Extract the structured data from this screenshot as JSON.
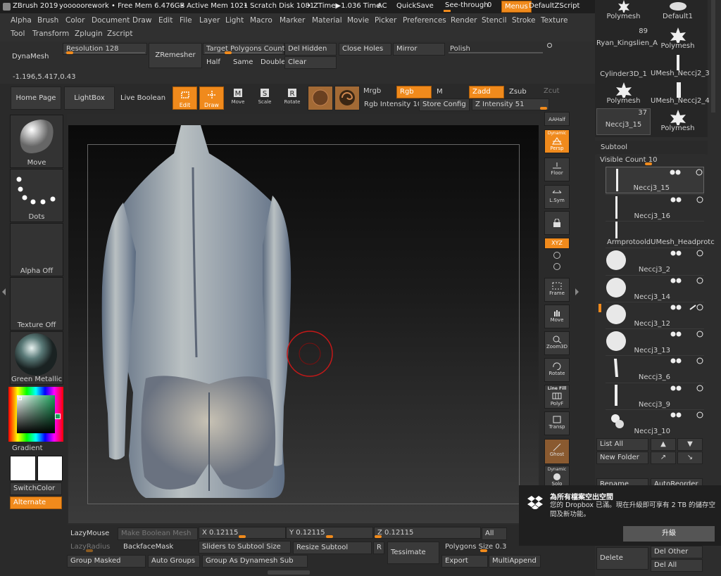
{
  "titlebar": {
    "app": "ZBrush 2019",
    "doc": "yooooorework",
    "free_mem": "• Free Mem 6.476GB",
    "active_mem": "• Active Mem 1021",
    "scratch": "• Scratch Disk 1081",
    "ztime": "• ZTime▶1.036 Time",
    "ac": "AC",
    "quicksave": "QuickSave",
    "see_through": "See-through",
    "see_through_val": "0",
    "menus": "Menus",
    "default_zscript": "DefaultZScript"
  },
  "menus": {
    "row1": [
      "Alpha",
      "Brush",
      "Color",
      "Document",
      "Draw",
      "Edit",
      "File",
      "Layer",
      "Light",
      "Macro",
      "Marker",
      "Material",
      "Movie",
      "Picker",
      "Preferences",
      "Render",
      "Stencil",
      "Stroke",
      "Texture"
    ],
    "row2": [
      "Tool",
      "Transform",
      "Zplugin",
      "Zscript"
    ]
  },
  "dynamesh": {
    "title": "DynaMesh",
    "resolution": "Resolution",
    "resolution_val": "128",
    "zremesher": "ZRemesher",
    "target_polys": "Target Polygons Count",
    "target_polys_val": "5",
    "half": "Half",
    "same": "Same",
    "double": "Double",
    "del_hidden": "Del Hidden",
    "clear": "Clear",
    "close_holes": "Close Holes",
    "mirror": "Mirror",
    "polish": "Polish",
    "coords": "-1.196,5.417,0.43"
  },
  "toolbar": {
    "home_page": "Home Page",
    "lightbox": "LightBox",
    "live_boolean": "Live Boolean",
    "edit": "Edit",
    "draw": "Draw",
    "move": "Move",
    "scale": "Scale",
    "rotate": "Rotate",
    "mrgb": "Mrgb",
    "rgb": "Rgb",
    "m": "M",
    "zadd": "Zadd",
    "zsub": "Zsub",
    "zcut": "Zcut",
    "rgb_intensity": "Rgb Intensity",
    "rgb_intensity_val": "100",
    "store_config": "Store Config",
    "z_intensity": "Z Intensity",
    "z_intensity_val": "51"
  },
  "left_shelf": {
    "brush": "Move",
    "stroke": "Dots",
    "alpha": "Alpha Off",
    "texture": "Texture Off",
    "material": "Green Metallic",
    "gradient": "Gradient",
    "switch_color": "SwitchColor",
    "alternate": "Alternate"
  },
  "right_shelf": {
    "aahalf": "AAHalf",
    "dynamic": "Dynamic",
    "persp": "Persp",
    "floor": "Floor",
    "lsym": "L.Sym",
    "xyz": "XYZ",
    "frame": "Frame",
    "move": "Move",
    "zoom3d": "Zoom3D",
    "rotate": "Rotate",
    "line_fill": "Line Fill",
    "polyf": "PolyF",
    "transp": "Transp",
    "ghost": "Ghost",
    "dynamic2": "Dynamic",
    "solo": "Solo"
  },
  "tool_thumbs": [
    {
      "label": "Polymesh",
      "count": ""
    },
    {
      "label": "Default1",
      "count": ""
    },
    {
      "label": "Ryan_Kingslien_A",
      "count": "89"
    },
    {
      "label": "Polymesh",
      "count": ""
    },
    {
      "label": "Cylinder3D_1",
      "count": ""
    },
    {
      "label": "UMesh_Neccj2_3",
      "count": ""
    },
    {
      "label": "Polymesh",
      "count": ""
    },
    {
      "label": "UMesh_Neccj2_4",
      "count": ""
    },
    {
      "label": "Neccj3_15",
      "count": "37"
    },
    {
      "label": "Polymesh",
      "count": ""
    }
  ],
  "subtool": {
    "title": "Subtool",
    "visible_count": "Visible Count",
    "visible_count_val": "10",
    "items": [
      "Neccj3_15",
      "Neccj3_16",
      "ArmprotooldUMesh_Headprotc",
      "Neccj3_2",
      "Neccj3_14",
      "Neccj3_12",
      "Neccj3_13",
      "Neccj3_6",
      "Neccj3_9",
      "Neccj3_10"
    ],
    "list_all": "List All",
    "new_folder": "New Folder",
    "rename": "Rename",
    "auto_reorder": "AutoReorder",
    "delete": "Delete",
    "del_other": "Del Other",
    "del_all": "Del All"
  },
  "bottom": {
    "lazymouse": "LazyMouse",
    "make_boolean": "Make Boolean Mesh",
    "x_label": "X",
    "x_val": "0.12115",
    "y_label": "Y",
    "y_val": "0.12115",
    "z_label": "Z",
    "z_val": "0.12115",
    "all": "All",
    "lazyradius": "LazyRadius",
    "backface": "BackfaceMask",
    "sliders_subtool": "Sliders to Subtool Size",
    "resize_subtool": "Resize Subtool",
    "r": "R",
    "tessimate": "Tessimate",
    "polygons_size": "Polygons Size",
    "polygons_size_val": "0.3",
    "group_masked": "Group Masked",
    "auto_groups": "Auto Groups",
    "group_dynamesh": "Group As Dynamesh Sub",
    "export": "Export",
    "multiappend": "MultiAppend"
  },
  "dropbox": {
    "title": "為所有檔案空出空間",
    "body": "您的 Dropbox 已滿。現在升級即可享有 2 TB 的儲存空間及新功能。",
    "upgrade": "升級"
  },
  "colors": {
    "accent": "#f08a1c",
    "panel": "#3a3a3a",
    "bg": "#2a2a2a"
  }
}
